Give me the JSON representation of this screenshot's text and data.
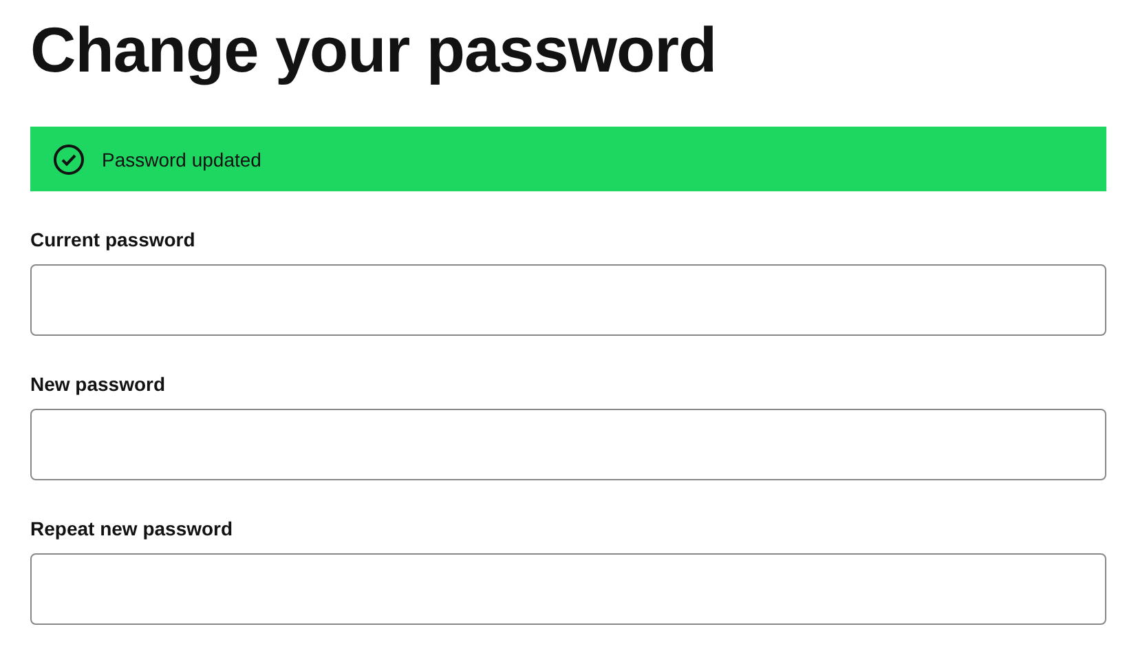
{
  "title": "Change your password",
  "alert": {
    "kind": "success",
    "text": "Password updated"
  },
  "fields": [
    {
      "label": "Current password"
    },
    {
      "label": "New password"
    },
    {
      "label": "Repeat new password"
    }
  ]
}
